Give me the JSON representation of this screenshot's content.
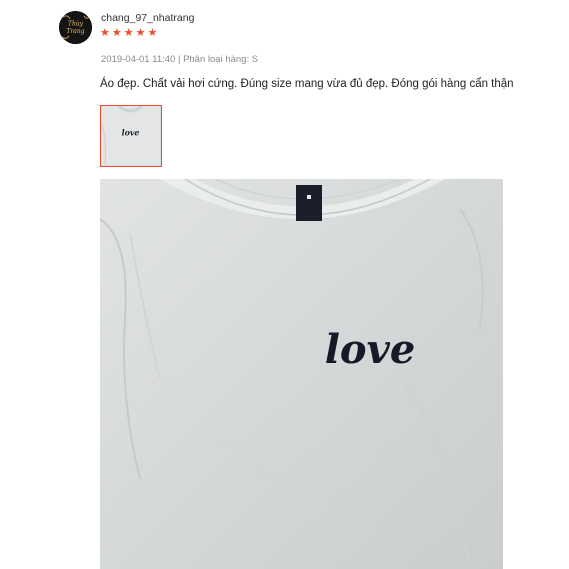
{
  "review": {
    "username": "chang_97_nhatrang",
    "avatar_text": "Thùy Trang",
    "rating": 5,
    "star_icon": "★",
    "datetime": "2019-04-01 11:40",
    "separator": " | ",
    "variation_label": "Phân loại hàng:",
    "variation_value": " S",
    "comment": "Áo đẹp. Chất vải hơi cứng. Đúng size mang vừa đủ đẹp. Đóng gói hàng cẩn thận",
    "print_text": "love"
  },
  "colors": {
    "star": "#ee4d2d",
    "thumbnail_border": "#ee4d2d",
    "meta_text": "#8a8a8a"
  }
}
